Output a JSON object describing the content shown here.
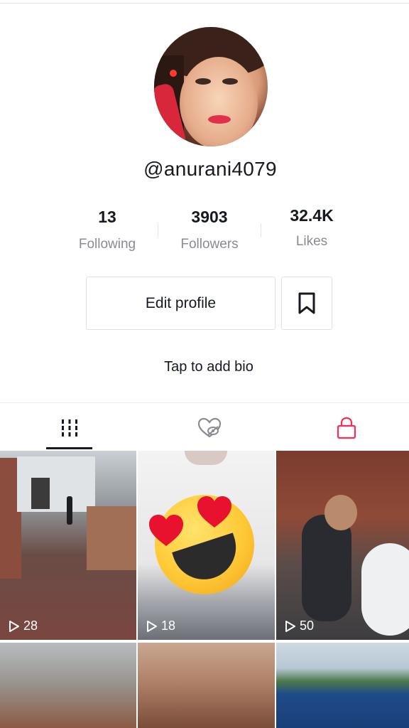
{
  "profile": {
    "username": "@anurani4079",
    "stats": {
      "following": {
        "value": "13",
        "label": "Following"
      },
      "followers": {
        "value": "3903",
        "label": "Followers"
      },
      "likes": {
        "value": "32.4K",
        "label": "Likes"
      }
    },
    "edit_label": "Edit profile",
    "bio_prompt": "Tap to add bio"
  },
  "tabs": [
    {
      "name": "videos",
      "icon": "grid-icon",
      "active": true
    },
    {
      "name": "liked",
      "icon": "liked-hidden-icon",
      "active": false
    },
    {
      "name": "private",
      "icon": "lock-icon",
      "active": false
    }
  ],
  "videos": [
    {
      "views": "28"
    },
    {
      "views": "18"
    },
    {
      "views": "50"
    },
    {
      "views": ""
    },
    {
      "views": ""
    },
    {
      "views": ""
    }
  ],
  "colors": {
    "text_primary": "#161823",
    "text_secondary": "#8a8b91",
    "border": "#e1e1e3",
    "lock_accent": "#fe2c55"
  }
}
